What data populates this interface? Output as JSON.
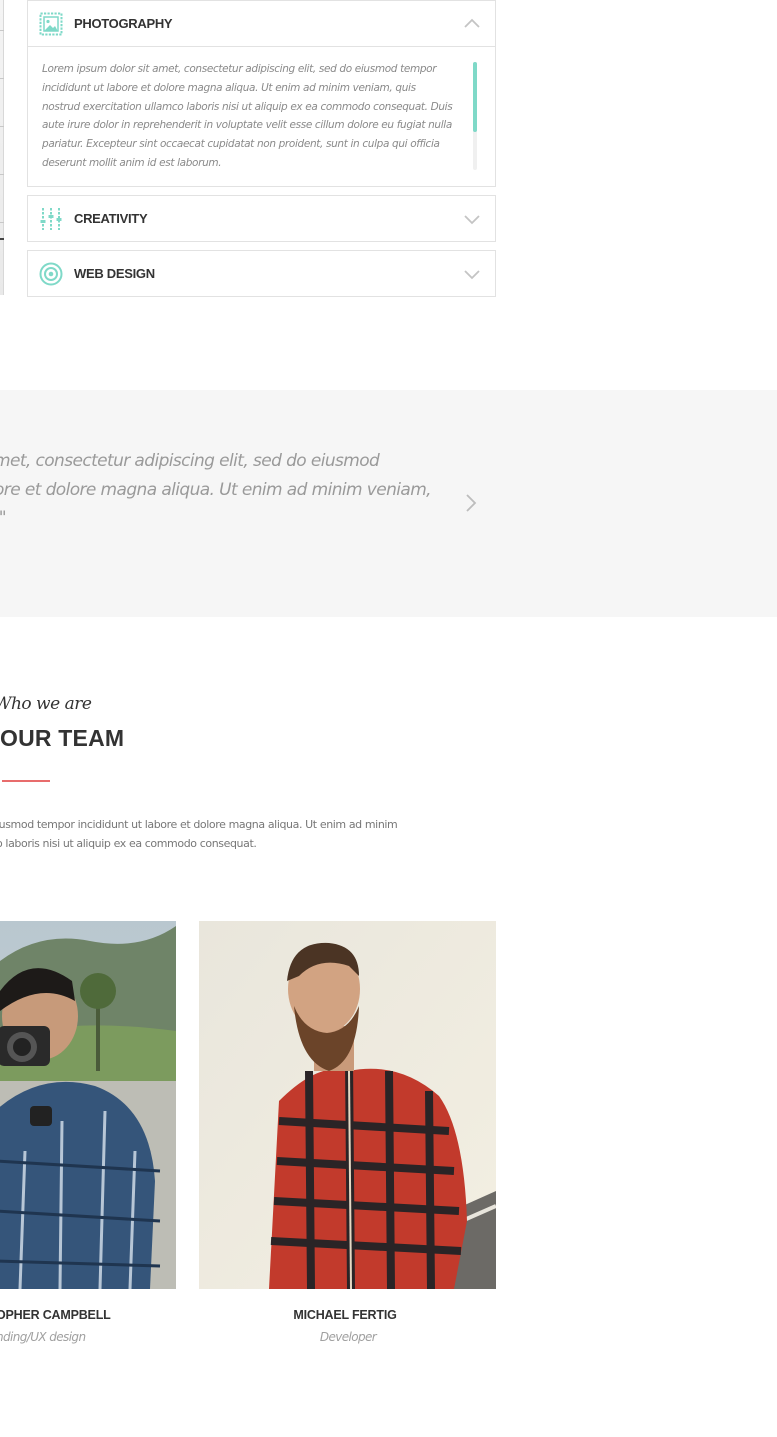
{
  "accordion": [
    {
      "title": "PHOTOGRAPHY",
      "icon": "image-icon",
      "expanded": true,
      "body": "Lorem ipsum dolor sit amet, consectetur adipiscing elit, sed do eiusmod tempor incididunt ut labore et dolore magna aliqua. Ut enim ad minim veniam, quis nostrud exercitation ullamco laboris nisi ut aliquip ex ea commodo consequat. Duis aute irure dolor in reprehenderit in voluptate velit esse cillum dolore eu fugiat nulla pariatur. Excepteur sint occaecat cupidatat non proident, sunt in culpa qui officia deserunt mollit anim id est laborum."
    },
    {
      "title": "CREATIVITY",
      "icon": "sliders-icon",
      "expanded": false
    },
    {
      "title": "WEB DESIGN",
      "icon": "target-icon",
      "expanded": false
    }
  ],
  "testimonial": {
    "text": "met, consectetur adipiscing elit, sed do eiusmod\nore et dolore magna aliqua. Ut enim ad minim veniam,\n.\""
  },
  "team": {
    "kicker": "Who we are",
    "title": "OUR TEAM",
    "description": "iusmod tempor incididunt ut labore et dolore magna aliqua. Ut enim ad minim\no laboris nisi ut aliquip ex ea commodo consequat.",
    "members": [
      {
        "name": "OPHER CAMPBELL",
        "role": "nding/UX design"
      },
      {
        "name": "MICHAEL FERTIG",
        "role": "Developer"
      }
    ]
  },
  "colors": {
    "accent_teal": "#7fd9c8",
    "accent_red": "#e86c6c",
    "band_bg": "#f6f6f6"
  }
}
